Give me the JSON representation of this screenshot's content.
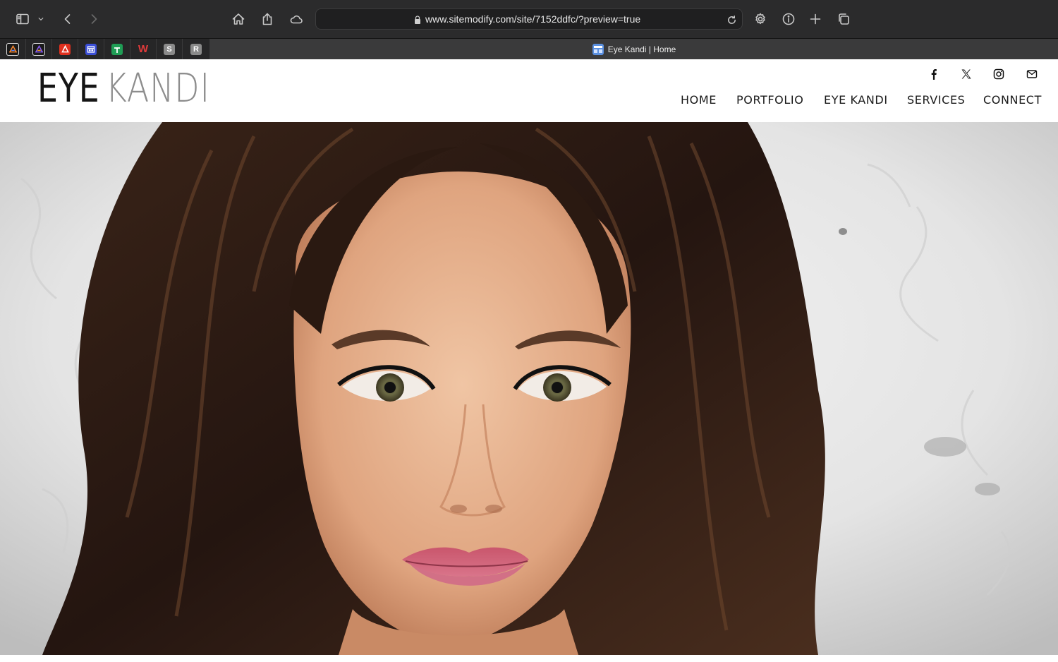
{
  "browser": {
    "url": "www.sitemodify.com/site/7152ddfc/?preview=true",
    "active_tab_title": "Eye Kandi | Home",
    "pinned_tabs": [
      {
        "icon": "app-a-icon",
        "letter": "A",
        "bg": "#1a1a1a",
        "fg": "#ff7a2f"
      },
      {
        "icon": "app-a-icon",
        "letter": "A",
        "bg": "#1a1a1a",
        "fg": "#8b5cf6"
      },
      {
        "icon": "adobe-icon",
        "letter": "A",
        "bg": "#e0301e",
        "fg": "#ffffff"
      },
      {
        "icon": "calendar-icon",
        "letter": "▤",
        "bg": "#3b4fd8",
        "fg": "#ffffff"
      },
      {
        "icon": "sheets-icon",
        "letter": "+",
        "bg": "#1f9d55",
        "fg": "#ffffff"
      },
      {
        "icon": "w-icon",
        "letter": "W",
        "bg": "transparent",
        "fg": "#e23b3b"
      },
      {
        "icon": "s-icon",
        "letter": "S",
        "bg": "#8a8a8a",
        "fg": "#ffffff"
      },
      {
        "icon": "r-icon",
        "letter": "R",
        "bg": "#8a8a8a",
        "fg": "#ffffff"
      }
    ]
  },
  "site": {
    "logo_part1": "EYE",
    "logo_part2": "KANDI",
    "social": [
      "facebook-icon",
      "x-icon",
      "instagram-icon",
      "mail-icon"
    ],
    "nav": [
      "HOME",
      "PORTFOLIO",
      "EYE KANDI",
      "SERVICES",
      "CONNECT"
    ]
  },
  "hero": {
    "image": "portrait-photo"
  }
}
